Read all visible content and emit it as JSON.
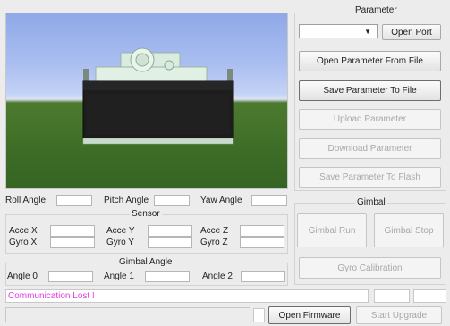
{
  "parameter": {
    "title": "Parameter",
    "port_combo_value": "",
    "open_port_label": "Open Port",
    "open_param_file_label": "Open Parameter From File",
    "save_param_file_label": "Save Parameter To File",
    "upload_param_label": "Upload Parameter",
    "download_param_label": "Download Parameter",
    "save_param_flash_label": "Save Parameter To Flash"
  },
  "angles": {
    "roll_label": "Roll Angle",
    "pitch_label": "Pitch Angle",
    "yaw_label": "Yaw Angle",
    "roll_value": "",
    "pitch_value": "",
    "yaw_value": ""
  },
  "sensor": {
    "title": "Sensor",
    "acce_x_label": "Acce X",
    "acce_y_label": "Acce Y",
    "acce_z_label": "Acce Z",
    "gyro_x_label": "Gyro X",
    "gyro_y_label": "Gyro Y",
    "gyro_z_label": "Gyro Z"
  },
  "gimbal_angle": {
    "title": "Gimbal Angle",
    "angle0_label": "Angle 0",
    "angle1_label": "Angle 1",
    "angle2_label": "Angle 2"
  },
  "gimbal": {
    "title": "Gimbal",
    "run_label": "Gimbal Run",
    "stop_label": "Gimbal Stop",
    "gyro_cal_label": "Gyro Calibration"
  },
  "status": {
    "message": "Communication Lost !"
  },
  "firmware": {
    "open_label": "Open Firmware",
    "upgrade_label": "Start Upgrade"
  },
  "icons": {
    "combo_arrow": "dropdown-arrow-icon"
  }
}
